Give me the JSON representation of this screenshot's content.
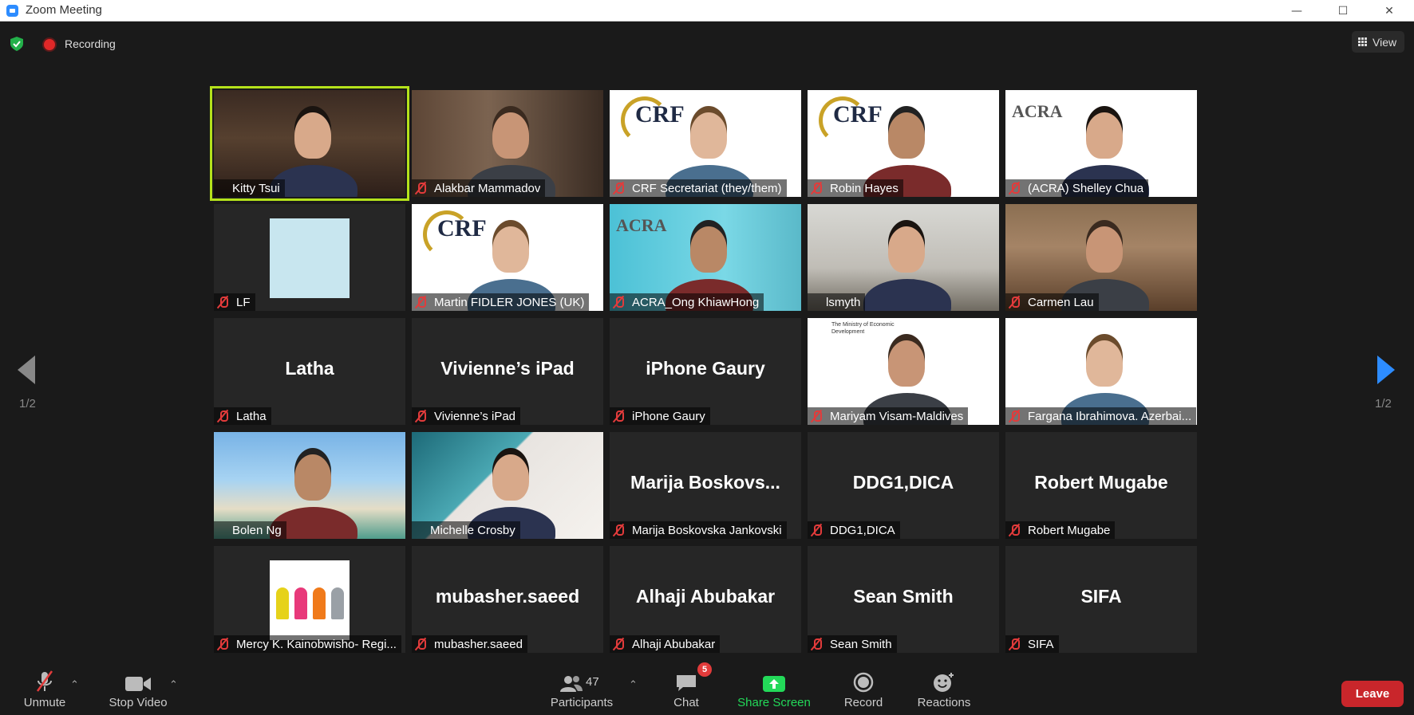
{
  "window": {
    "title": "Zoom Meeting"
  },
  "top_bar": {
    "recording_label": "Recording",
    "view_label": "View"
  },
  "pager": {
    "left": "1/2",
    "right": "1/2"
  },
  "tiles": [
    {
      "name": "Kitty Tsui",
      "video": true,
      "muted": false,
      "active": true,
      "bg": "office"
    },
    {
      "name": "Alakbar Mammadov",
      "video": true,
      "muted": true,
      "bg": "books"
    },
    {
      "name": "CRF Secretariat (they/them)",
      "video": true,
      "muted": true,
      "bg": "white",
      "logo": "CRF"
    },
    {
      "name": "Robin Hayes",
      "video": true,
      "muted": true,
      "bg": "white",
      "logo": "CRF"
    },
    {
      "name": "(ACRA) Shelley Chua",
      "video": true,
      "muted": true,
      "bg": "white",
      "logo": "ACRA"
    },
    {
      "name": "LF",
      "video": false,
      "muted": true,
      "avatar": "acra"
    },
    {
      "name": "Martin FIDLER JONES (UK)",
      "video": true,
      "muted": true,
      "bg": "white",
      "logo": "CRF"
    },
    {
      "name": "ACRA_Ong KhiawHong",
      "video": true,
      "muted": true,
      "bg": "teal",
      "logo": "ACRA"
    },
    {
      "name": "lsmyth",
      "video": true,
      "muted": false,
      "bg": "room"
    },
    {
      "name": "Carmen Lau",
      "video": true,
      "muted": true,
      "bg": "wood"
    },
    {
      "name": "Latha",
      "video": false,
      "muted": true,
      "display": "Latha"
    },
    {
      "name": "Vivienne’s iPad",
      "video": false,
      "muted": true,
      "display": "Vivienne’s iPad"
    },
    {
      "name": "iPhone Gaury",
      "video": false,
      "muted": true,
      "display": "iPhone Gaury"
    },
    {
      "name": "Mariyam Visam-Maldives",
      "video": true,
      "muted": true,
      "bg": "white",
      "logo": "The Ministry of Economic Development"
    },
    {
      "name": "Fargana Ibrahimova. Azerbai...",
      "video": true,
      "muted": true,
      "bg": "white"
    },
    {
      "name": "Bolen Ng",
      "video": true,
      "muted": false,
      "bg": "beach"
    },
    {
      "name": "Michelle Crosby",
      "video": true,
      "muted": false,
      "bg": "blue-doc"
    },
    {
      "name": "Marija Boskovska Jankovski",
      "video": false,
      "muted": true,
      "display": "Marija  Boskovs..."
    },
    {
      "name": "DDG1,DICA",
      "video": false,
      "muted": true,
      "display": "DDG1,DICA"
    },
    {
      "name": "Robert Mugabe",
      "video": false,
      "muted": true,
      "display": "Robert Mugabe"
    },
    {
      "name": "Mercy K. Kainobwisho- Regi...",
      "video": false,
      "muted": true,
      "avatar": "mercy"
    },
    {
      "name": "mubasher.saeed",
      "video": false,
      "muted": true,
      "display": "mubasher.saeed"
    },
    {
      "name": "Alhaji Abubakar",
      "video": false,
      "muted": true,
      "display": "Alhaji Abubakar"
    },
    {
      "name": "Sean Smith",
      "video": false,
      "muted": true,
      "display": "Sean Smith"
    },
    {
      "name": "SIFA",
      "video": false,
      "muted": true,
      "display": "SIFA"
    }
  ],
  "toolbar": {
    "unmute_label": "Unmute",
    "stop_video_label": "Stop Video",
    "participants_label": "Participants",
    "participants_count": "47",
    "chat_label": "Chat",
    "chat_badge": "5",
    "share_label": "Share Screen",
    "record_label": "Record",
    "reactions_label": "Reactions",
    "leave_label": "Leave"
  },
  "colors": {
    "active_speaker": "#b5e21b",
    "share": "#23d959",
    "leave": "#c9262b",
    "accent": "#2d8cff",
    "muted": "#e23b3b"
  }
}
